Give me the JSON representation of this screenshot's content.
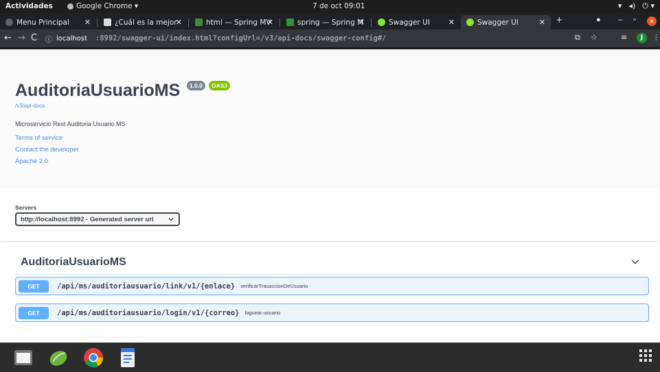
{
  "topbar": {
    "activities": "Actividades",
    "app": "Google Chrome ▾",
    "clock": "7 de oct  09:01"
  },
  "tabs": [
    {
      "label": "Menu Principal",
      "color": "#5f6368"
    },
    {
      "label": "¿Cuál es la mejor",
      "color": "#ddd"
    },
    {
      "label": "html — Spring MV",
      "color": "#3a8f3a"
    },
    {
      "label": "spring — Spring M",
      "color": "#3a8f3a"
    },
    {
      "label": "Swagger UI",
      "color": "#85ea2d"
    },
    {
      "label": "Swagger UI",
      "color": "#85ea2d"
    }
  ],
  "address": {
    "host": "localhost",
    "path": ":8992/swagger-ui/index.html?configUrl=/v3/api-docs/swagger-config#/"
  },
  "profile_initial": "J",
  "info": {
    "title": "AuditoriaUsuarioMS",
    "version": "1.0.0",
    "oas": "OAS3",
    "api_docs_link": "/v3/api-docs",
    "description": "Microservicio Rest Auditoria Usuario MS",
    "terms": "Terms of service",
    "contact": "Contact the developer",
    "license": "Apache 2.0"
  },
  "servers": {
    "label": "Servers",
    "selected": "http://localhost:8992 - Generated server url"
  },
  "tag": {
    "name": "AuditoriaUsuarioMS",
    "operations": [
      {
        "method": "GET",
        "path": "/api/ms/auditoriausuario/link/v1/{enlace}",
        "summary": "verificarTrasaccionDeUsuario"
      },
      {
        "method": "GET",
        "path": "/api/ms/auditoriausuario/login/v1/{correo}",
        "summary": "loguear usuario"
      }
    ]
  },
  "colors": {
    "get": "#61affe",
    "oas": "#89bf04",
    "link": "#4990e2"
  }
}
